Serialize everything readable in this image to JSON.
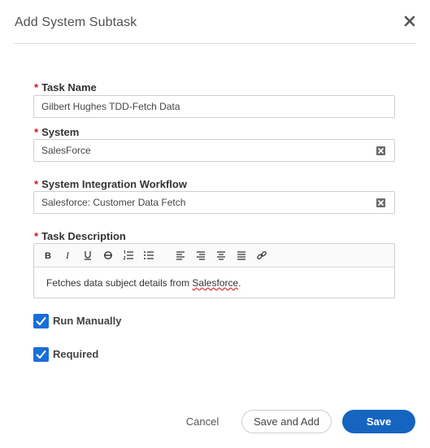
{
  "dialog": {
    "title": "Add System Subtask",
    "close_icon": "close-x-icon"
  },
  "form": {
    "required_marker": "*",
    "task_name": {
      "label": "Task Name",
      "value": "Gilbert Hughes TDD-Fetch Data"
    },
    "system": {
      "label": "System",
      "value": "SalesForce",
      "clear_icon": "clear-x-icon"
    },
    "workflow": {
      "label": "System Integration Workflow",
      "value": "Salesforce: Customer Data Fetch",
      "clear_icon": "clear-x-icon"
    },
    "description": {
      "label": "Task Description",
      "toolbar": [
        "bold-icon",
        "italic-icon",
        "underline-icon",
        "strikethrough-icon",
        "ordered-list-icon",
        "unordered-list-icon",
        "align-left-icon",
        "align-right-icon",
        "align-center-icon",
        "align-justify-icon",
        "link-icon"
      ],
      "text_prefix": "Fetches data subject details from ",
      "text_misspelled": "Salesforce",
      "text_suffix": "."
    },
    "run_manually": {
      "label": "Run Manually",
      "checked": true
    },
    "required": {
      "label": "Required",
      "checked": true
    }
  },
  "footer": {
    "cancel_label": "Cancel",
    "save_and_add_label": "Save and Add",
    "save_label": "Save"
  },
  "colors": {
    "accent": "#1565c0",
    "checkbox": "#1a6ed8",
    "required": "#c8102e"
  }
}
